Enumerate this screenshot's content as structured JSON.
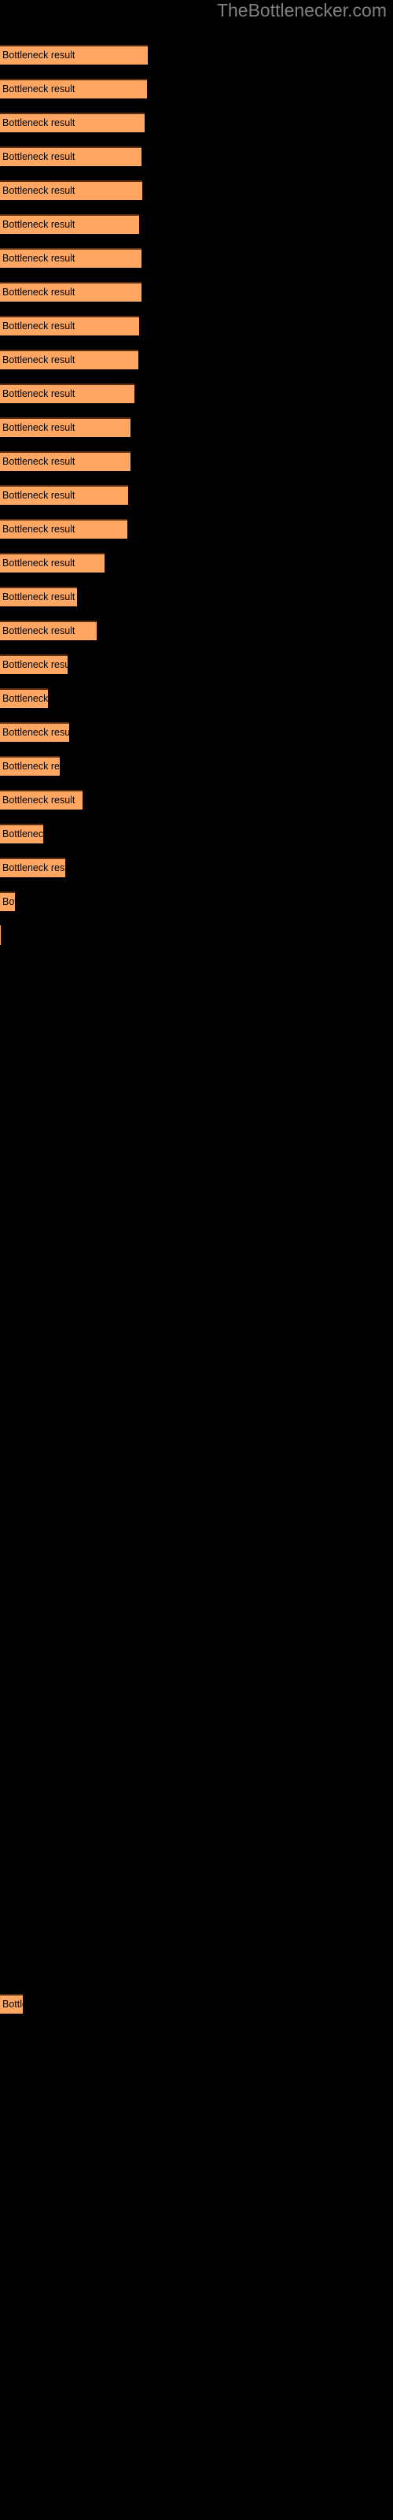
{
  "site": {
    "title": "TheBottlenecker.com",
    "title_color": "#808080"
  },
  "colors": {
    "background": "#000000",
    "bar_fill": "#ffa762",
    "bar_border": "#5c2f12",
    "label_text": "#000000"
  },
  "chart_data": {
    "type": "bar",
    "orientation": "horizontal",
    "title": "",
    "subtitle": "",
    "xlabel": "",
    "ylabel": "",
    "grid": false,
    "legend": null,
    "bar_label": "Bottleneck result",
    "categories": [
      "Bottleneck result",
      "Bottleneck result",
      "Bottleneck result",
      "Bottleneck result",
      "Bottleneck result",
      "Bottleneck result",
      "Bottleneck result",
      "Bottleneck result",
      "Bottleneck result",
      "Bottleneck result",
      "Bottleneck result",
      "Bottleneck result",
      "Bottleneck result",
      "Bottleneck result",
      "Bottleneck result",
      "Bottleneck result",
      "Bottleneck result",
      "Bottleneck result",
      "Bottleneck result",
      "Bottleneck result",
      "Bottleneck result",
      "Bottleneck result",
      "Bottleneck result",
      "Bottleneck result",
      "Bottleneck result",
      "Bottleneck result",
      "Bottleneck result",
      "Bottleneck result",
      "Bottleneck result",
      "Bottleneck result"
    ],
    "values": [
      188,
      187,
      184,
      180,
      181,
      177,
      180,
      180,
      177,
      176,
      171,
      166,
      166,
      163,
      162,
      133,
      98,
      123,
      86,
      61,
      88,
      76,
      105,
      55,
      83,
      19,
      1,
      0,
      0,
      29
    ],
    "xlim": [
      0,
      188
    ],
    "bars": [
      {
        "y": 57,
        "width": 188,
        "label": "Bottleneck result"
      },
      {
        "y": 100,
        "width": 187,
        "label": "Bottleneck result"
      },
      {
        "y": 143,
        "width": 184,
        "label": "Bottleneck result"
      },
      {
        "y": 186,
        "width": 180,
        "label": "Bottleneck result"
      },
      {
        "y": 229,
        "width": 181,
        "label": "Bottleneck result"
      },
      {
        "y": 272,
        "width": 177,
        "label": "Bottleneck result"
      },
      {
        "y": 315,
        "width": 180,
        "label": "Bottleneck result"
      },
      {
        "y": 358,
        "width": 180,
        "label": "Bottleneck result"
      },
      {
        "y": 401,
        "width": 177,
        "label": "Bottleneck result"
      },
      {
        "y": 444,
        "width": 176,
        "label": "Bottleneck result"
      },
      {
        "y": 487,
        "width": 171,
        "label": "Bottleneck result"
      },
      {
        "y": 530,
        "width": 166,
        "label": "Bottleneck result"
      },
      {
        "y": 573,
        "width": 166,
        "label": "Bottleneck result"
      },
      {
        "y": 616,
        "width": 163,
        "label": "Bottleneck result"
      },
      {
        "y": 659,
        "width": 162,
        "label": "Bottleneck result"
      },
      {
        "y": 702,
        "width": 133,
        "label": "Bottleneck result"
      },
      {
        "y": 745,
        "width": 98,
        "label": "Bottleneck result"
      },
      {
        "y": 788,
        "width": 123,
        "label": "Bottleneck result"
      },
      {
        "y": 831,
        "width": 86,
        "label": "Bottleneck result"
      },
      {
        "y": 874,
        "width": 61,
        "label": "Bottleneck result"
      },
      {
        "y": 917,
        "width": 88,
        "label": "Bottleneck result"
      },
      {
        "y": 960,
        "width": 76,
        "label": "Bottleneck result"
      },
      {
        "y": 1003,
        "width": 105,
        "label": "Bottleneck result"
      },
      {
        "y": 1046,
        "width": 55,
        "label": "Bottleneck result"
      },
      {
        "y": 1089,
        "width": 83,
        "label": "Bottleneck result"
      },
      {
        "y": 1132,
        "width": 19,
        "label": "Bottleneck result"
      },
      {
        "y": 1175,
        "width": 1,
        "label": "Bottleneck result"
      },
      {
        "y": 1218,
        "width": 0,
        "label": "Bottleneck result"
      },
      {
        "y": 1261,
        "width": 0,
        "label": "Bottleneck result"
      },
      {
        "y": 1304,
        "width": 29,
        "label": "Bottleneck result"
      }
    ]
  }
}
